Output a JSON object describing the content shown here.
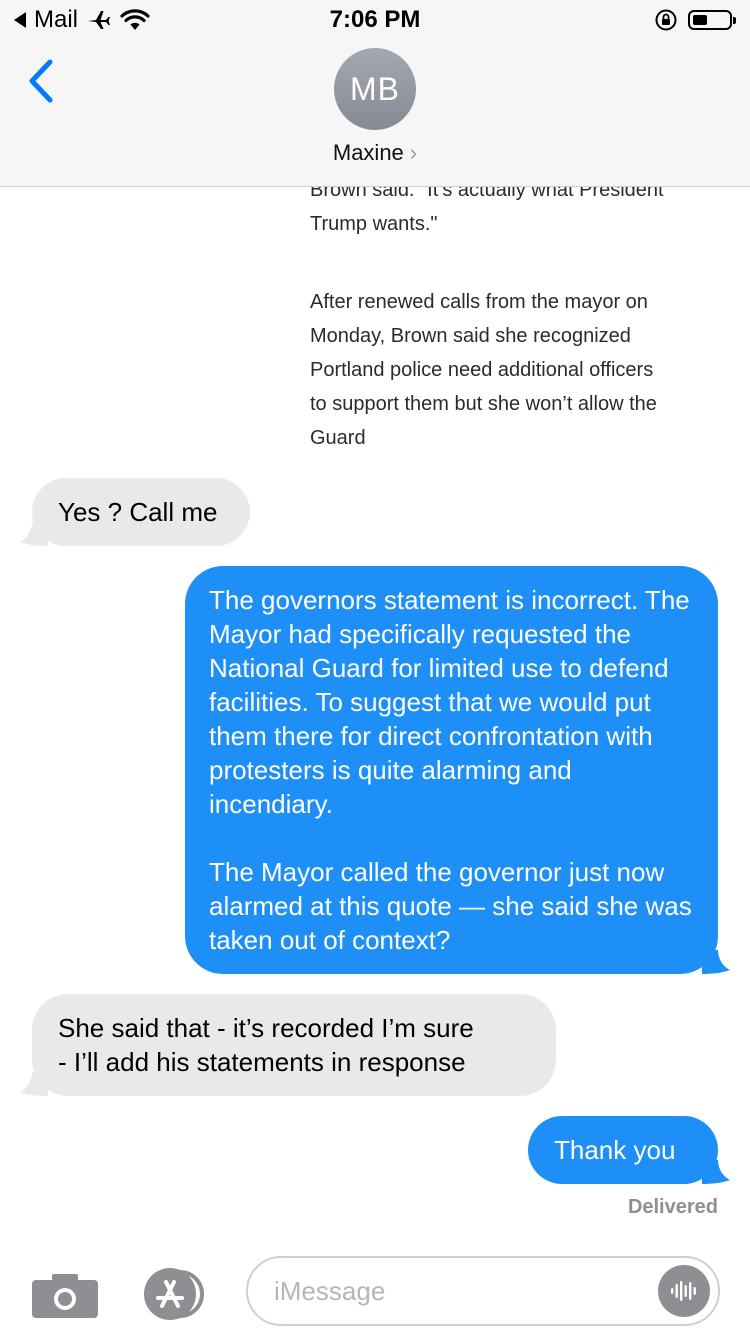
{
  "status_bar": {
    "back_app": "Mail",
    "time": "7:06 PM",
    "icons": [
      "airplane-icon",
      "wifi-icon",
      "orientation-lock-icon",
      "battery-icon"
    ]
  },
  "header": {
    "avatar_initials": "MB",
    "contact_name": "Maxine",
    "chevron": "›"
  },
  "article_image": {
    "paragraph_1": "Brown said. \"It’s actually what President Trump wants.\"",
    "paragraph_2": "After renewed calls from the mayor on Monday, Brown said she recognized Portland police need additional officers to support them but she won’t allow the Guard"
  },
  "messages": [
    {
      "direction": "received",
      "text": "Yes ? Call me"
    },
    {
      "direction": "sent",
      "text": "The governors statement is incorrect. The Mayor had specifically requested the National Guard for limited use to defend facilities. To suggest that we would put them there for direct confrontation with protesters is quite alarming and incendiary.\n\nThe Mayor called the governor just now alarmed at this quote — she said she was taken out of context?"
    },
    {
      "direction": "received",
      "text": "She said that - it’s recorded I’m sure\n- I’ll add his statements in response"
    },
    {
      "direction": "sent",
      "text": "Thank you"
    }
  ],
  "delivered_label": "Delivered",
  "composer": {
    "placeholder": "iMessage"
  },
  "colors": {
    "sent_bubble": "#1e8ff7",
    "received_bubble": "#e9e9eb",
    "accent": "#007aff"
  }
}
